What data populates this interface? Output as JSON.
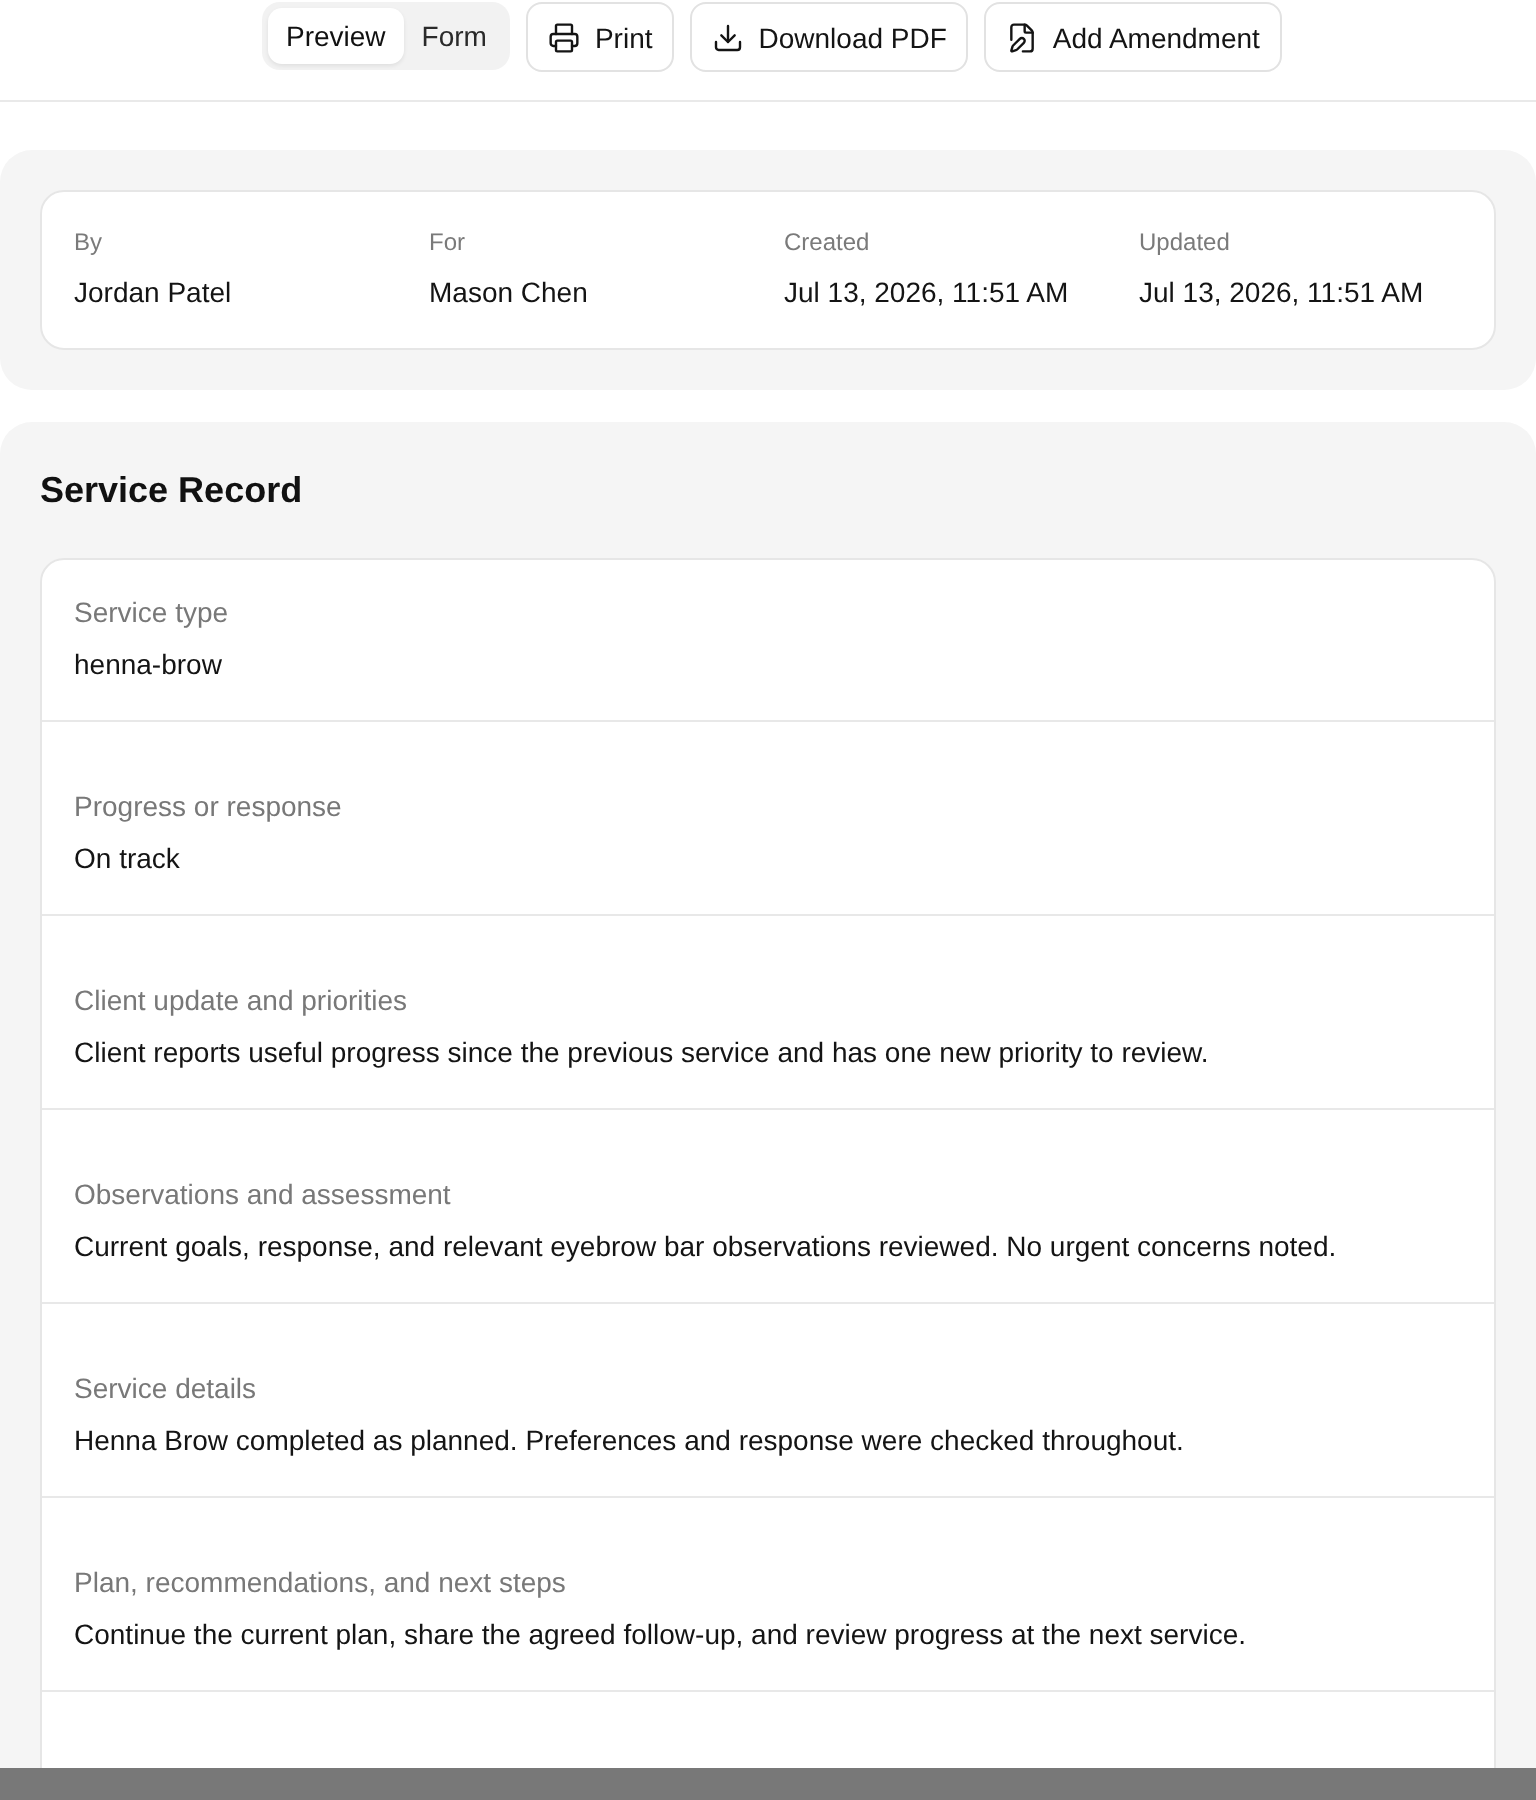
{
  "toolbar": {
    "view_tabs": [
      {
        "label": "Preview",
        "selected": true
      },
      {
        "label": "Form",
        "selected": false
      }
    ],
    "actions": [
      {
        "label": "Print"
      },
      {
        "label": "Download PDF"
      },
      {
        "label": "Add Amendment"
      }
    ]
  },
  "meta": [
    {
      "label": "By",
      "value": "Jordan Patel"
    },
    {
      "label": "For",
      "value": "Mason Chen"
    },
    {
      "label": "Created",
      "value": "Jul 13, 2026, 11:51 AM"
    },
    {
      "label": "Updated",
      "value": "Jul 13, 2026, 11:51 AM"
    }
  ],
  "record": {
    "title": "Service Record",
    "fields": [
      {
        "label": "Service type",
        "value": "henna-brow"
      },
      {
        "label": "Progress or response",
        "value": "On track"
      },
      {
        "label": "Client update and priorities",
        "value": "Client reports useful progress since the previous service and has one new priority to review."
      },
      {
        "label": "Observations and assessment",
        "value": "Current goals, response, and relevant eyebrow bar observations reviewed. No urgent concerns noted."
      },
      {
        "label": "Service details",
        "value": "Henna Brow completed as planned. Preferences and response were checked throughout."
      },
      {
        "label": "Plan, recommendations, and next steps",
        "value": "Continue the current plan, share the agreed follow-up, and review progress at the next service."
      }
    ]
  }
}
